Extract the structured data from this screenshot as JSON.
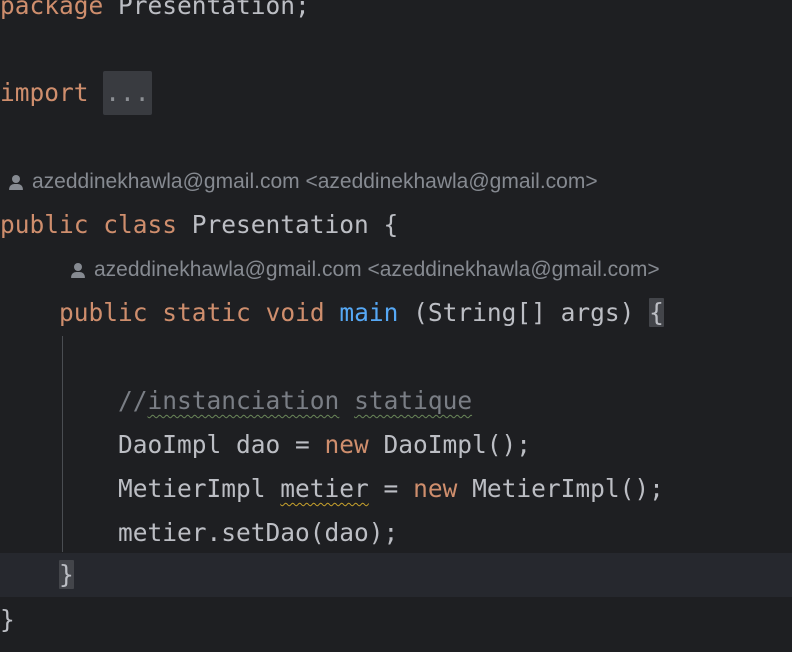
{
  "code": {
    "line_package": {
      "keyword": "package",
      "name": " Presentation;"
    },
    "line_import": {
      "keyword": "import",
      "folded": "..."
    },
    "author1": {
      "text": "azeddinekhawla@gmail.com <azeddinekhawla@gmail.com>"
    },
    "line_class": {
      "kw1": "public",
      "kw2": "class",
      "name": " Presentation {"
    },
    "author2": {
      "text": "azeddinekhawla@gmail.com <azeddinekhawla@gmail.com>"
    },
    "line_main": {
      "kw1": "public",
      "kw2": "static",
      "kw3": "void",
      "fn": "main",
      "rest": " (String[] args) ",
      "brace": "{"
    },
    "line_comment": {
      "slashes": "//",
      "word1": "instanciation",
      "space": " ",
      "word2": "statique"
    },
    "line_dao": {
      "pre": "DaoImpl dao = ",
      "kw": "new",
      "post": " DaoImpl();"
    },
    "line_metier": {
      "pre": "MetierImpl ",
      "var": "metier",
      "mid": " = ",
      "kw": "new",
      "post": " MetierImpl();"
    },
    "line_setdao": {
      "text": "metier.setDao(dao);"
    },
    "line_close_method": {
      "brace": "}"
    },
    "line_close_class": {
      "brace": "}"
    }
  },
  "colors": {
    "background": "#1e1f22",
    "keyword": "#cf8e6d",
    "function": "#56a8f5",
    "comment": "#7a7e85",
    "text": "#bcbec4"
  },
  "icons": {
    "author": "person-icon"
  }
}
